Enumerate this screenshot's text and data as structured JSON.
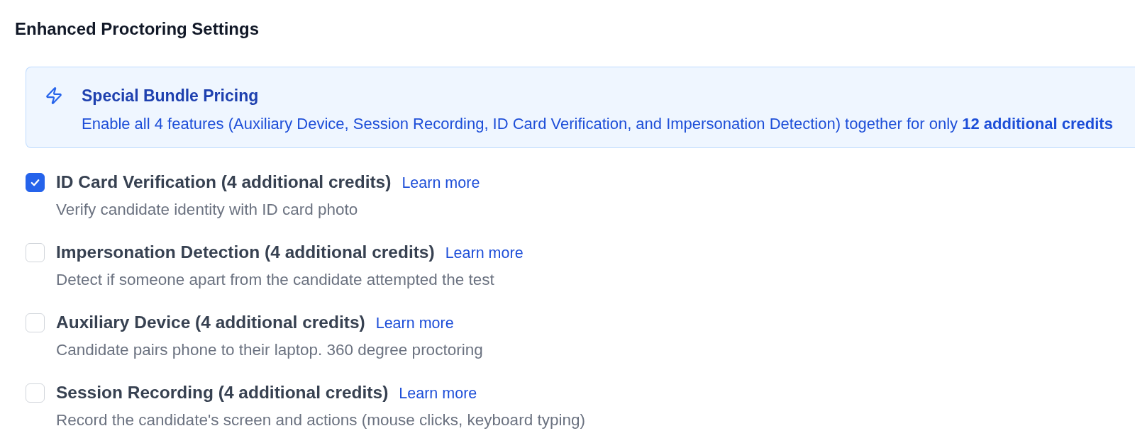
{
  "title": "Enhanced Proctoring Settings",
  "bundle": {
    "title": "Special Bundle Pricing",
    "description": "Enable all 4 features (Auxiliary Device, Session Recording, ID Card Verification, and Impersonation Detection) together for only **12 additional credits**"
  },
  "options": [
    {
      "label": "ID Card Verification (4 additional credits)",
      "link": "Learn more",
      "description": "Verify candidate identity with ID card photo",
      "checked": true
    },
    {
      "label": "Impersonation Detection (4 additional credits)",
      "link": "Learn more",
      "description": "Detect if someone apart from the candidate attempted the test",
      "checked": false
    },
    {
      "label": "Auxiliary Device (4 additional credits)",
      "link": "Learn more",
      "description": "Candidate pairs phone to their laptop. 360 degree proctoring",
      "checked": false
    },
    {
      "label": "Session Recording (4 additional credits)",
      "link": "Learn more",
      "description": "Record the candidate's screen and actions (mouse clicks, keyboard typing)",
      "checked": false
    }
  ]
}
